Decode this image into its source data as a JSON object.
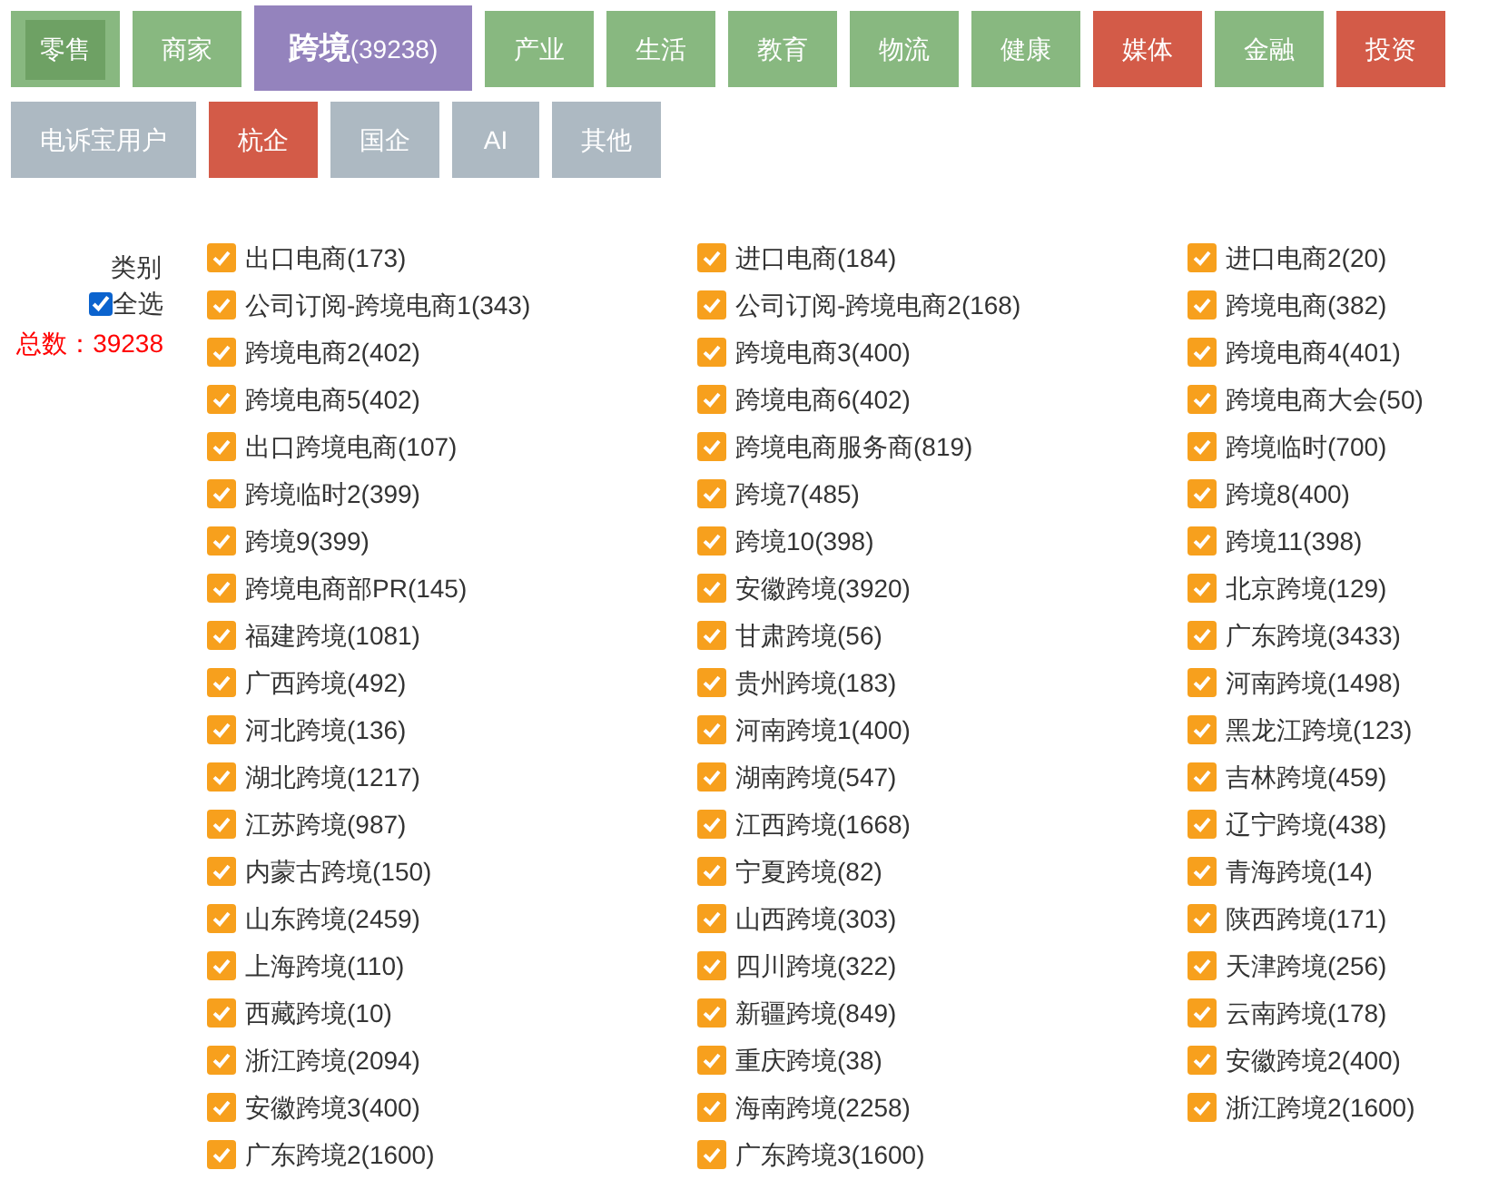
{
  "tabs": [
    {
      "label": "零售",
      "color": "#88b880",
      "selected": false,
      "focused": true
    },
    {
      "label": "商家",
      "color": "#88b880",
      "selected": false,
      "focused": false
    },
    {
      "label": "跨境",
      "count": "(39238)",
      "color": "#9483bd",
      "selected": true,
      "focused": false
    },
    {
      "label": "产业",
      "color": "#88b880",
      "selected": false,
      "focused": false
    },
    {
      "label": "生活",
      "color": "#88b880",
      "selected": false,
      "focused": false
    },
    {
      "label": "教育",
      "color": "#88b880",
      "selected": false,
      "focused": false
    },
    {
      "label": "物流",
      "color": "#88b880",
      "selected": false,
      "focused": false
    },
    {
      "label": "健康",
      "color": "#88b880",
      "selected": false,
      "focused": false
    },
    {
      "label": "媒体",
      "color": "#d35b48",
      "selected": false,
      "focused": false
    },
    {
      "label": "金融",
      "color": "#88b880",
      "selected": false,
      "focused": false
    },
    {
      "label": "投资",
      "color": "#d35b48",
      "selected": false,
      "focused": false
    },
    {
      "label": "电诉宝用户",
      "color": "#adb9c2",
      "selected": false,
      "focused": false
    },
    {
      "label": "杭企",
      "color": "#d35b48",
      "selected": false,
      "focused": false
    },
    {
      "label": "国企",
      "color": "#adb9c2",
      "selected": false,
      "focused": false
    },
    {
      "label": "AI",
      "color": "#adb9c2",
      "selected": false,
      "focused": false
    },
    {
      "label": "其他",
      "color": "#adb9c2",
      "selected": false,
      "focused": false
    }
  ],
  "filter": {
    "heading": "类别",
    "select_all": {
      "label": "全选",
      "checked": true
    },
    "total": "总数：39238"
  },
  "categories": [
    {
      "label": "出口电商(173)",
      "checked": true
    },
    {
      "label": "进口电商(184)",
      "checked": true
    },
    {
      "label": "进口电商2(20)",
      "checked": true
    },
    {
      "label": "公司订阅-跨境电商1(343)",
      "checked": true
    },
    {
      "label": "公司订阅-跨境电商2(168)",
      "checked": true
    },
    {
      "label": "跨境电商(382)",
      "checked": true
    },
    {
      "label": "跨境电商2(402)",
      "checked": true
    },
    {
      "label": "跨境电商3(400)",
      "checked": true
    },
    {
      "label": "跨境电商4(401)",
      "checked": true
    },
    {
      "label": "跨境电商5(402)",
      "checked": true
    },
    {
      "label": "跨境电商6(402)",
      "checked": true
    },
    {
      "label": "跨境电商大会(50)",
      "checked": true
    },
    {
      "label": "出口跨境电商(107)",
      "checked": true
    },
    {
      "label": "跨境电商服务商(819)",
      "checked": true
    },
    {
      "label": "跨境临时(700)",
      "checked": true
    },
    {
      "label": "跨境临时2(399)",
      "checked": true
    },
    {
      "label": "跨境7(485)",
      "checked": true
    },
    {
      "label": "跨境8(400)",
      "checked": true
    },
    {
      "label": "跨境9(399)",
      "checked": true
    },
    {
      "label": "跨境10(398)",
      "checked": true
    },
    {
      "label": "跨境11(398)",
      "checked": true
    },
    {
      "label": "跨境电商部PR(145)",
      "checked": true
    },
    {
      "label": "安徽跨境(3920)",
      "checked": true
    },
    {
      "label": "北京跨境(129)",
      "checked": true
    },
    {
      "label": "福建跨境(1081)",
      "checked": true
    },
    {
      "label": "甘肃跨境(56)",
      "checked": true
    },
    {
      "label": "广东跨境(3433)",
      "checked": true
    },
    {
      "label": "广西跨境(492)",
      "checked": true
    },
    {
      "label": "贵州跨境(183)",
      "checked": true
    },
    {
      "label": "河南跨境(1498)",
      "checked": true
    },
    {
      "label": "河北跨境(136)",
      "checked": true
    },
    {
      "label": "河南跨境1(400)",
      "checked": true
    },
    {
      "label": "黑龙江跨境(123)",
      "checked": true
    },
    {
      "label": "湖北跨境(1217)",
      "checked": true
    },
    {
      "label": "湖南跨境(547)",
      "checked": true
    },
    {
      "label": "吉林跨境(459)",
      "checked": true
    },
    {
      "label": "江苏跨境(987)",
      "checked": true
    },
    {
      "label": "江西跨境(1668)",
      "checked": true
    },
    {
      "label": "辽宁跨境(438)",
      "checked": true
    },
    {
      "label": "内蒙古跨境(150)",
      "checked": true
    },
    {
      "label": "宁夏跨境(82)",
      "checked": true
    },
    {
      "label": "青海跨境(14)",
      "checked": true
    },
    {
      "label": "山东跨境(2459)",
      "checked": true
    },
    {
      "label": "山西跨境(303)",
      "checked": true
    },
    {
      "label": "陕西跨境(171)",
      "checked": true
    },
    {
      "label": "上海跨境(110)",
      "checked": true
    },
    {
      "label": "四川跨境(322)",
      "checked": true
    },
    {
      "label": "天津跨境(256)",
      "checked": true
    },
    {
      "label": "西藏跨境(10)",
      "checked": true
    },
    {
      "label": "新疆跨境(849)",
      "checked": true
    },
    {
      "label": "云南跨境(178)",
      "checked": true
    },
    {
      "label": "浙江跨境(2094)",
      "checked": true
    },
    {
      "label": "重庆跨境(38)",
      "checked": true
    },
    {
      "label": "安徽跨境2(400)",
      "checked": true
    },
    {
      "label": "安徽跨境3(400)",
      "checked": true
    },
    {
      "label": "海南跨境(2258)",
      "checked": true
    },
    {
      "label": "浙江跨境2(1600)",
      "checked": true
    },
    {
      "label": "广东跨境2(1600)",
      "checked": true
    },
    {
      "label": "广东跨境3(1600)",
      "checked": true
    }
  ]
}
